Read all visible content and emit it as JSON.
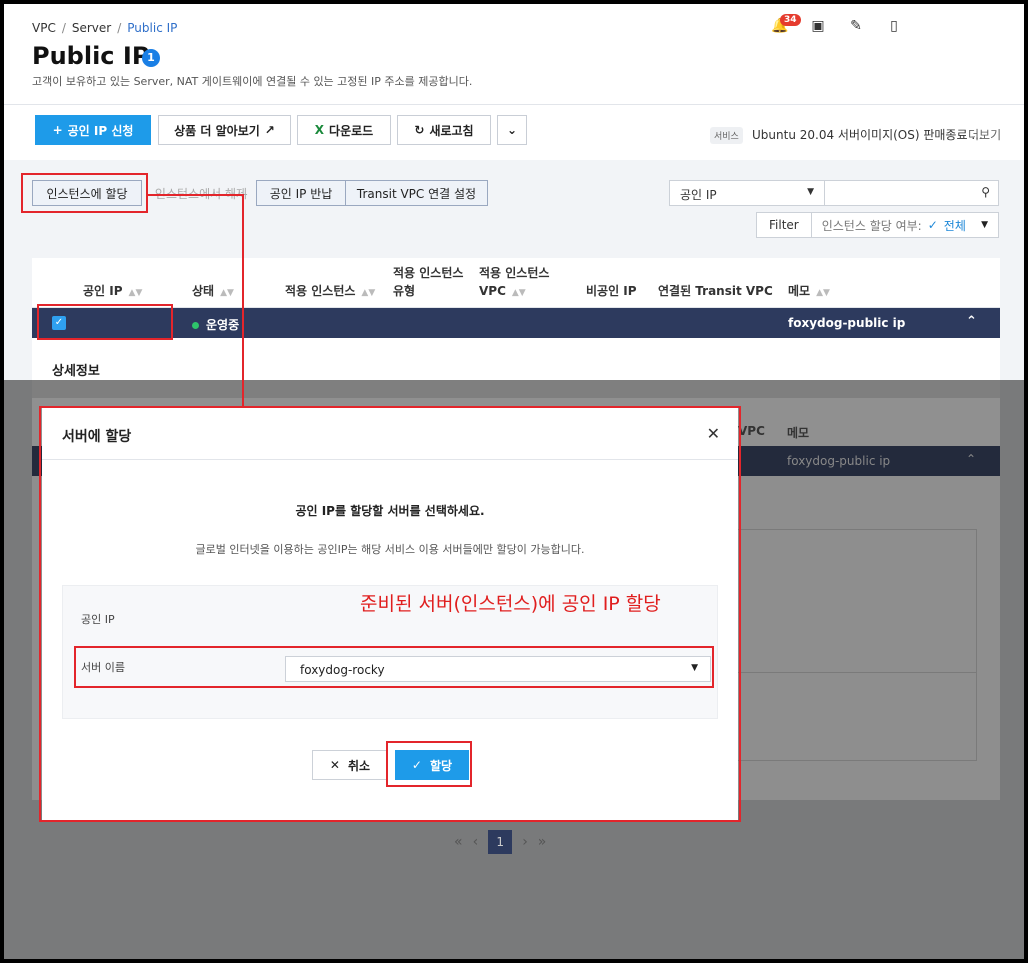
{
  "breadcrumb": [
    "VPC",
    "Server",
    "Public IP"
  ],
  "page_title": "Public IP",
  "info_badge": "1",
  "subtitle": "고객이 보유하고 있는 Server, NAT 게이트웨이에 연결될 수 있는 고정된 IP 주소를 제공합니다.",
  "notification_count": "34",
  "toolbar": {
    "apply_label": "공인 IP 신청",
    "learn_more_label": "상품 더 알아보기",
    "download_label": "다운로드",
    "refresh_label": "새로고침",
    "service_tag": "서비스",
    "service_notice": "Ubuntu 20.04 서버이미지(OS) 판매종료 ...",
    "more_label": "더보기"
  },
  "actions": {
    "assign": "인스턴스에 할당",
    "unassign": "인스턴스에서 해제",
    "return": "공인 IP 반납",
    "transit": "Transit VPC 연결 설정"
  },
  "search": {
    "field": "공인 IP",
    "value": ""
  },
  "filter": {
    "label": "Filter",
    "name": "인스턴스 할당 여부:",
    "value": "전체"
  },
  "table": {
    "headers": {
      "public_ip": "공인 IP",
      "status": "상태",
      "instance": "적용 인스턴스",
      "instance_type_1": "적용 인스턴스",
      "instance_type_2": "유형",
      "instance_vpc_1": "적용 인스턴스",
      "instance_vpc_2": "VPC",
      "private_ip": "비공인 IP",
      "transit_vpc": "연결된 Transit VPC",
      "memo": "메모"
    },
    "row": {
      "status": "운영중",
      "memo": "foxydog-public ip"
    }
  },
  "detail_title": "상세정보",
  "ghost": {
    "vpc": "VPC",
    "memo": "메모",
    "row_memo": "foxydog-public ip"
  },
  "pagination": {
    "current": "1"
  },
  "modal": {
    "title": "서버에 할당",
    "question": "공인 IP를 할당할 서버를 선택하세요.",
    "hint": "글로벌 인터넷을 이용하는 공인IP는 해당 서비스 이용 서버들에만 할당이 가능합니다.",
    "public_ip_label": "공인 IP",
    "server_name_label": "서버 이름",
    "server_selected": "foxydog-rocky",
    "cancel_label": "취소",
    "assign_label": "할당"
  },
  "annotation": "준비된 서버(인스턴스)에 공인 IP 할당",
  "colors": {
    "primary": "#1e9be9",
    "row_selected": "#2d3a5e",
    "highlight": "#e3252b",
    "status_ok": "#2ec46b"
  }
}
